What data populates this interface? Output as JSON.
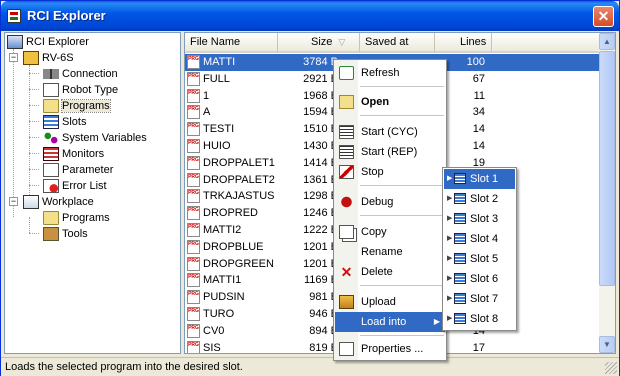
{
  "window": {
    "title": "RCI Explorer",
    "close_label": "✕"
  },
  "tree": {
    "items": [
      {
        "label": "RCI Explorer",
        "icon": "computer-icon"
      },
      {
        "label": "RV-6S",
        "icon": "robot-icon"
      },
      {
        "label": "Connection",
        "icon": "connection-icon"
      },
      {
        "label": "Robot Type",
        "icon": "document-icon"
      },
      {
        "label": "Programs",
        "icon": "folder-icon"
      },
      {
        "label": "Slots",
        "icon": "slots-icon"
      },
      {
        "label": "System Variables",
        "icon": "variables-icon"
      },
      {
        "label": "Monitors",
        "icon": "monitor-icon"
      },
      {
        "label": "Parameter",
        "icon": "parameter-icon"
      },
      {
        "label": "Error List",
        "icon": "error-list-icon"
      },
      {
        "label": "Workplace",
        "icon": "workplace-icon"
      },
      {
        "label": "Programs",
        "icon": "folder-icon"
      },
      {
        "label": "Tools",
        "icon": "tools-icon"
      }
    ]
  },
  "list": {
    "columns": {
      "name": "File Name",
      "size": "Size",
      "saved": "Saved at",
      "lines": "Lines"
    },
    "rows": [
      {
        "name": "MATTI",
        "size": "3784 B",
        "saved": "",
        "lines": "100",
        "selected": true
      },
      {
        "name": "FULL",
        "size": "2921 B",
        "saved": "",
        "lines": "67"
      },
      {
        "name": "1",
        "size": "1968 B",
        "saved": "",
        "lines": "11"
      },
      {
        "name": "A",
        "size": "1594 B",
        "saved": "",
        "lines": "34"
      },
      {
        "name": "TESTI",
        "size": "1510 B",
        "saved": "",
        "lines": "14"
      },
      {
        "name": "HUIO",
        "size": "1430 B",
        "saved": "",
        "lines": "14"
      },
      {
        "name": "DROPPALET1",
        "size": "1414 B",
        "saved": "",
        "lines": "19"
      },
      {
        "name": "DROPPALET2",
        "size": "1361 B",
        "saved": "",
        "lines": ""
      },
      {
        "name": "TRKAJASTUS",
        "size": "1298 B",
        "saved": "",
        "lines": ""
      },
      {
        "name": "DROPRED",
        "size": "1246 B",
        "saved": "",
        "lines": ""
      },
      {
        "name": "MATTI2",
        "size": "1222 B",
        "saved": "",
        "lines": ""
      },
      {
        "name": "DROPBLUE",
        "size": "1201 B",
        "saved": "",
        "lines": ""
      },
      {
        "name": "DROPGREEN",
        "size": "1201 B",
        "saved": "",
        "lines": ""
      },
      {
        "name": "MATTI1",
        "size": "1169 B",
        "saved": "",
        "lines": ""
      },
      {
        "name": "PUDSIN",
        "size": "981 B",
        "saved": "",
        "lines": ""
      },
      {
        "name": "TURO",
        "size": "946 B",
        "saved": "",
        "lines": ""
      },
      {
        "name": "CV0",
        "size": "894 B",
        "saved": "",
        "lines": "14"
      },
      {
        "name": "SIS",
        "size": "819 B",
        "saved": "",
        "lines": "17"
      }
    ]
  },
  "context_menu": {
    "items": [
      {
        "label": "Refresh",
        "icon": "refresh-icon"
      },
      {
        "label": "Open",
        "icon": "open-folder-icon",
        "bold": true
      },
      {
        "label": "Start (CYC)",
        "icon": "start-cycle-icon"
      },
      {
        "label": "Start (REP)",
        "icon": "start-repeat-icon"
      },
      {
        "label": "Stop",
        "icon": "stop-icon"
      },
      {
        "label": "Debug",
        "icon": "debug-icon"
      },
      {
        "label": "Copy",
        "icon": "copy-icon"
      },
      {
        "label": "Rename",
        "icon": ""
      },
      {
        "label": "Delete",
        "icon": "delete-icon"
      },
      {
        "label": "Upload",
        "icon": "upload-icon"
      },
      {
        "label": "Load into",
        "icon": "",
        "active": true,
        "submenu": true
      },
      {
        "label": "Properties ...",
        "icon": "properties-icon"
      }
    ]
  },
  "load_into_submenu": {
    "items": [
      {
        "label": "Slot 1",
        "active": true
      },
      {
        "label": "Slot 2"
      },
      {
        "label": "Slot 3"
      },
      {
        "label": "Slot 4"
      },
      {
        "label": "Slot 5"
      },
      {
        "label": "Slot 6"
      },
      {
        "label": "Slot 7"
      },
      {
        "label": "Slot 8"
      }
    ]
  },
  "status_bar": {
    "text": "Loads the selected program into the desired slot."
  },
  "colors": {
    "selection": "#316ac5",
    "titlebar": "#0058e6",
    "error": "#e02020"
  }
}
